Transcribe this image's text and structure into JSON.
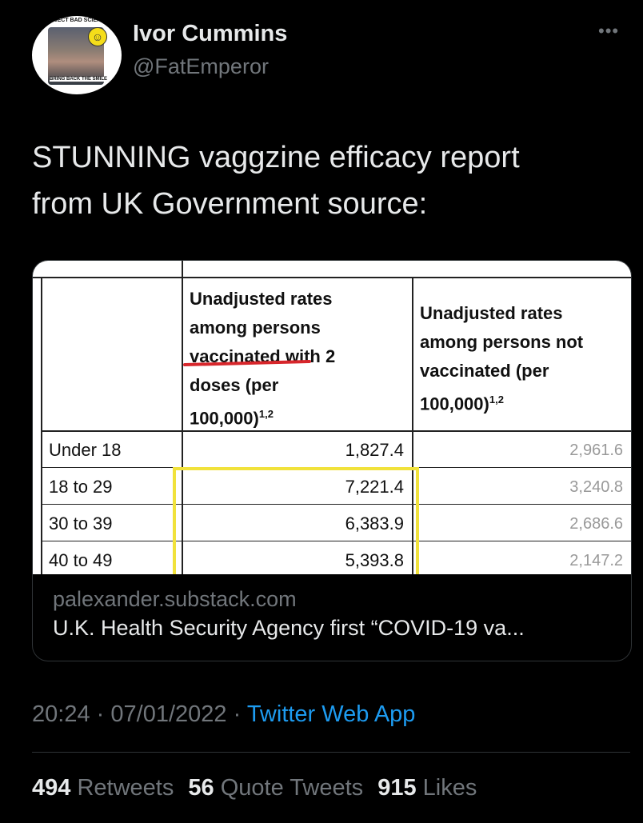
{
  "author": {
    "display_name": "Ivor Cummins",
    "handle": "@FatEmperor",
    "avatar_top_text": "REJECT BAD SCIENCE",
    "avatar_bottom_text": "BRING BACK THE SMILE"
  },
  "more_icon": "more-horizontal-icon",
  "tweet": {
    "text_line1": "STUNNING vaggzine efficacy report",
    "text_line2": "from UK Government source:"
  },
  "card": {
    "image_table": {
      "col1_header_lines": [
        "Unadjusted rates",
        "among persons",
        "vaccinated with 2",
        "doses (per",
        "100,000)"
      ],
      "col1_header_sup": "1,2",
      "col2_header_lines": [
        "Unadjusted rates",
        "among persons not",
        "vaccinated (per",
        "100,000)"
      ],
      "col2_header_sup": "1,2",
      "rows": [
        {
          "label": "Under 18",
          "vaccinated": "1,827.4",
          "not_vaccinated": "2,961.6"
        },
        {
          "label": "18 to 29",
          "vaccinated": "7,221.4",
          "not_vaccinated": "3,240.8"
        },
        {
          "label": "30 to 39",
          "vaccinated": "6,383.9",
          "not_vaccinated": "2,686.6"
        },
        {
          "label": "40 to 49",
          "vaccinated": "5,393.8",
          "not_vaccinated": "2,147.2"
        }
      ],
      "highlight_color": "#f1e23b",
      "underline_color": "#d7262b"
    },
    "domain": "palexander.substack.com",
    "title": "U.K. Health Security Agency first “COVID-19 va..."
  },
  "meta": {
    "time": "20:24",
    "date": "07/01/2022",
    "separator": "·",
    "source": "Twitter Web App"
  },
  "stats": {
    "retweets_count": "494",
    "retweets_label": "Retweets",
    "quotes_count": "56",
    "quotes_label": "Quote Tweets",
    "likes_count": "915",
    "likes_label": "Likes"
  },
  "colors": {
    "background": "#000000",
    "text": "#e7e9ea",
    "muted": "#71767b",
    "link": "#1d9bf0"
  }
}
